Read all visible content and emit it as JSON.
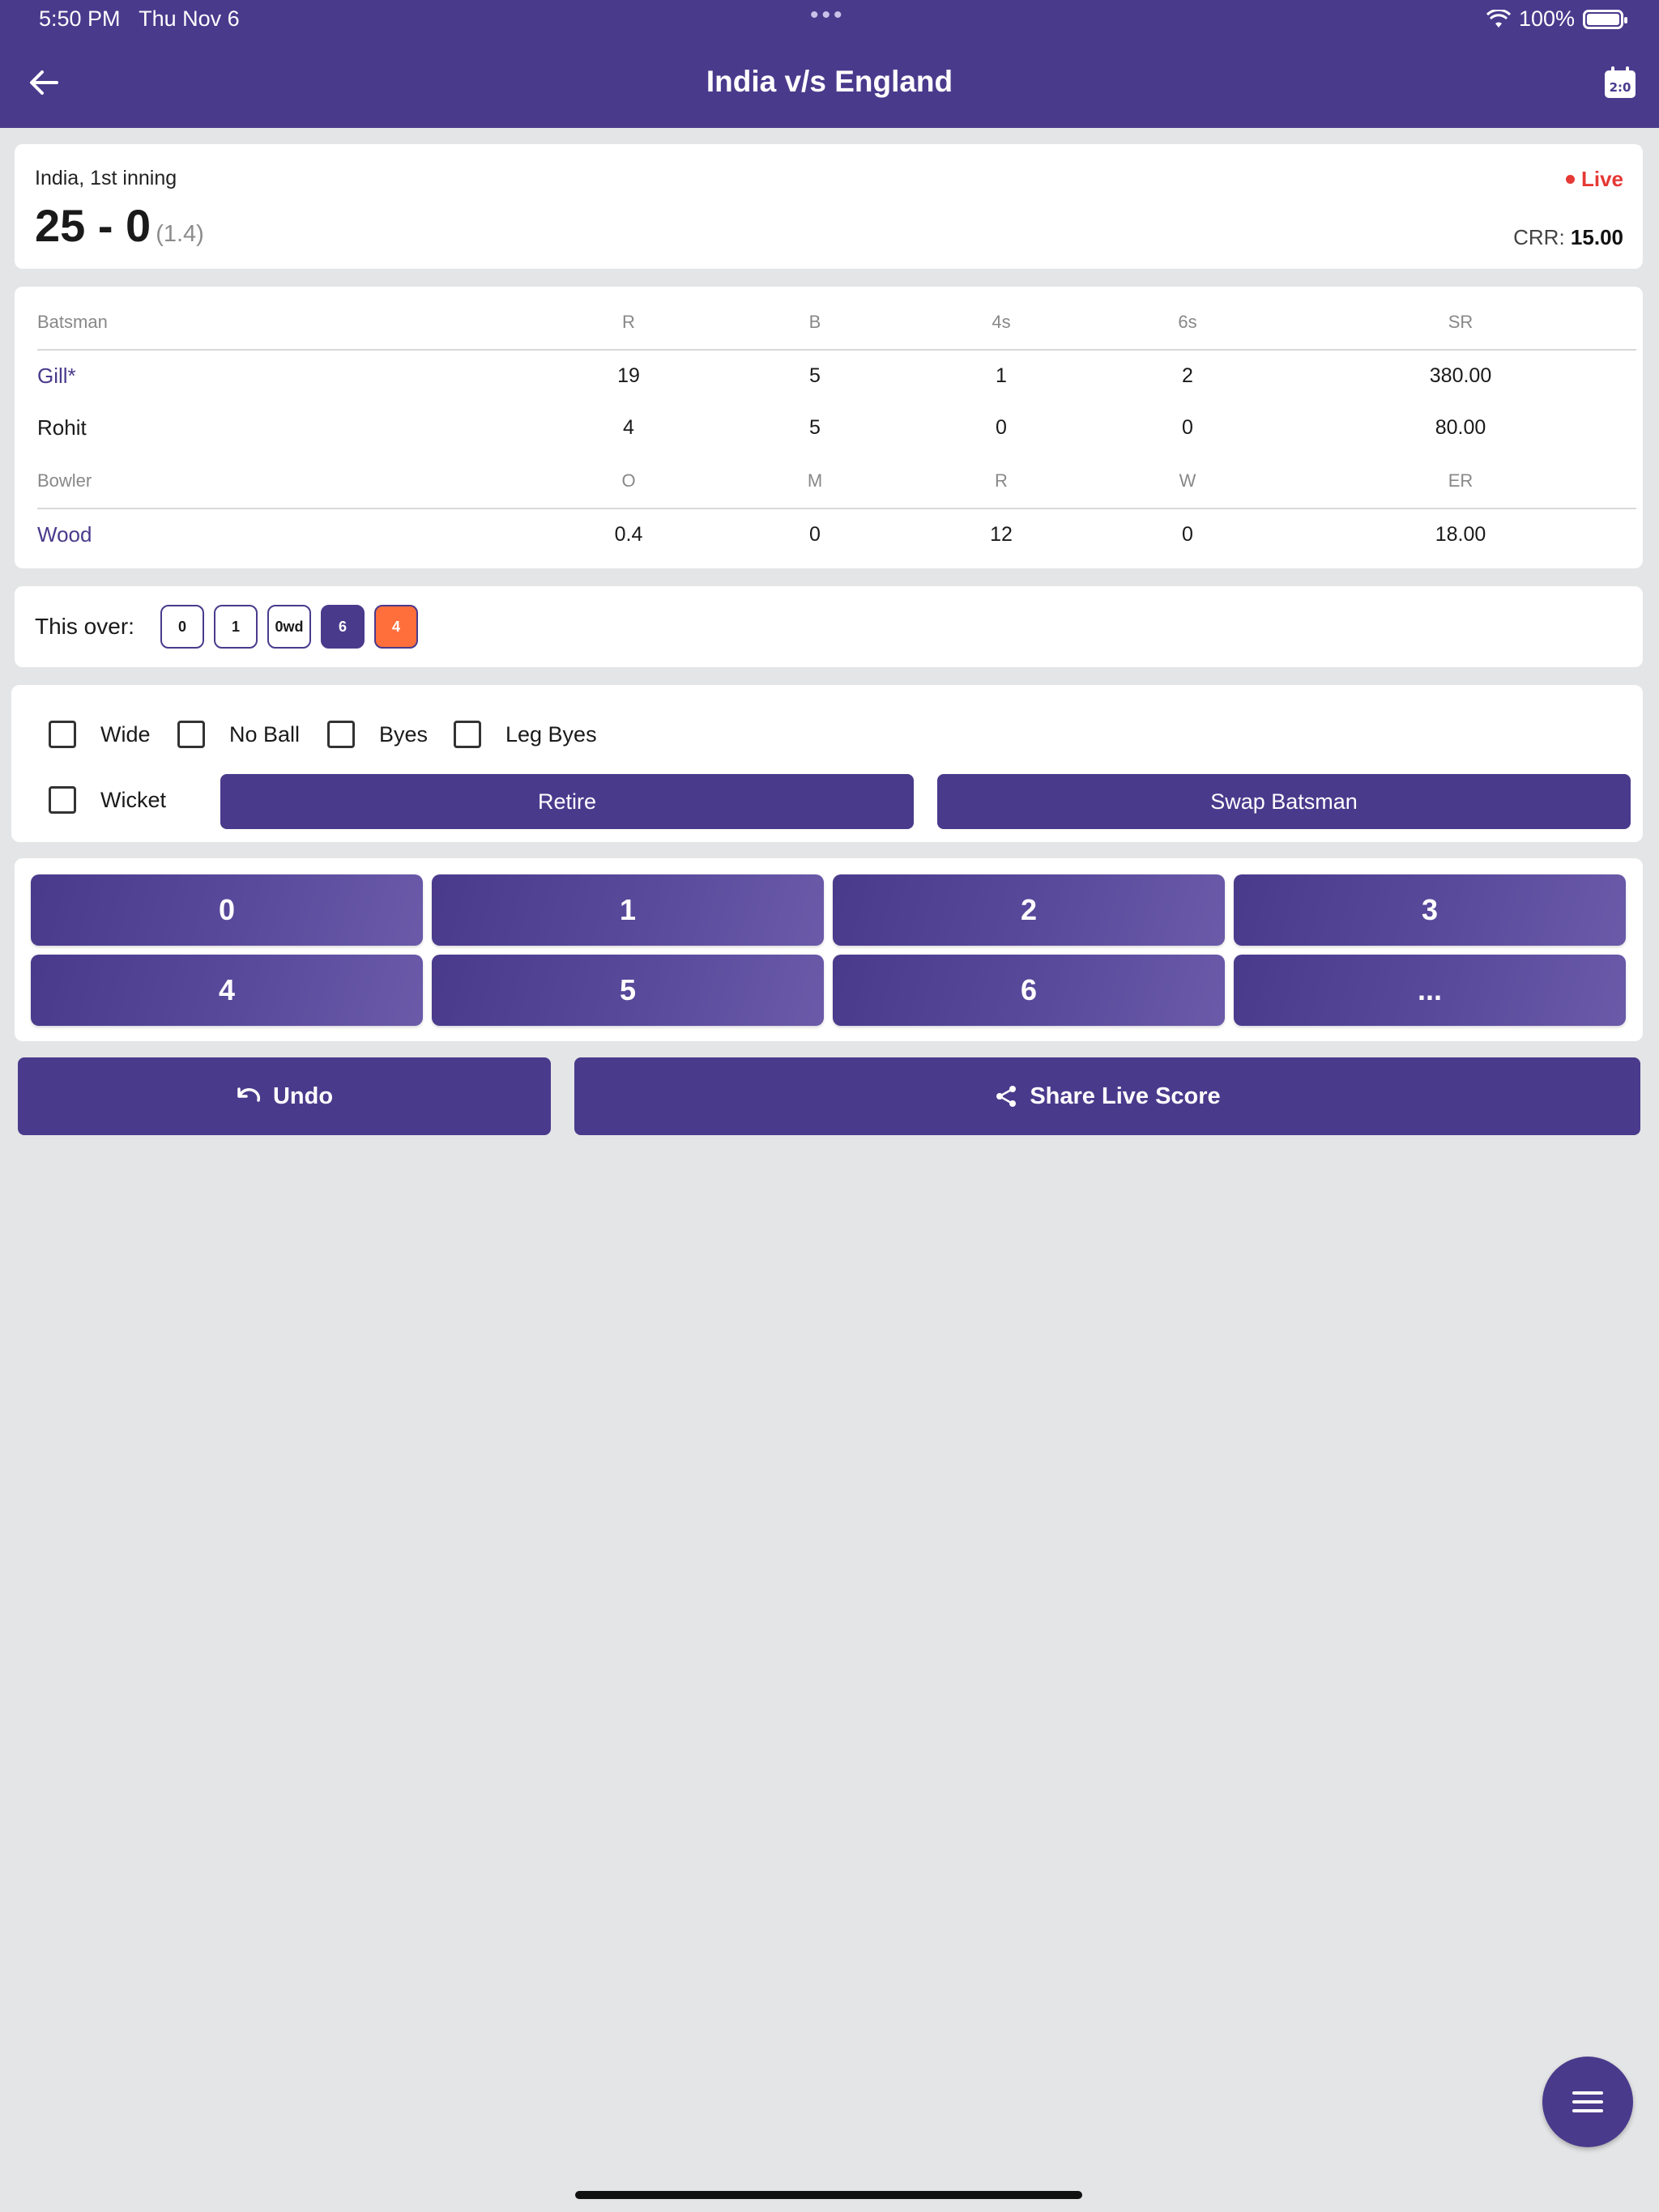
{
  "status_bar": {
    "time": "5:50 PM",
    "date": "Thu Nov 6",
    "battery": "100%",
    "dots": "•••"
  },
  "header": {
    "title": "India v/s England"
  },
  "score": {
    "innings": "India, 1st inning",
    "runs_wickets": "25 - 0",
    "overs": "(1.4)",
    "live": "Live",
    "crr_label": "CRR:",
    "crr_value": "15.00"
  },
  "batting": {
    "headers": [
      "Batsman",
      "R",
      "B",
      "4s",
      "6s",
      "SR"
    ],
    "rows": [
      [
        "Gill*",
        "19",
        "5",
        "1",
        "2",
        "380.00"
      ],
      [
        "Rohit",
        "4",
        "5",
        "0",
        "0",
        "80.00"
      ]
    ]
  },
  "bowling": {
    "headers": [
      "Bowler",
      "O",
      "M",
      "R",
      "W",
      "ER"
    ],
    "rows": [
      [
        "Wood",
        "0.4",
        "0",
        "12",
        "0",
        "18.00"
      ]
    ]
  },
  "this_over": {
    "label": "This over:",
    "balls": [
      "0",
      "1",
      "0wd",
      "6",
      "4"
    ]
  },
  "extras": {
    "wide": "Wide",
    "no_ball": "No Ball",
    "byes": "Byes",
    "leg_byes": "Leg Byes",
    "wicket": "Wicket",
    "retire": "Retire",
    "swap": "Swap Batsman"
  },
  "runs_pad": [
    "0",
    "1",
    "2",
    "3",
    "4",
    "5",
    "6",
    "..."
  ],
  "bottom": {
    "undo": "Undo",
    "share": "Share Live Score"
  },
  "colors": {
    "primary": "#4a3a8c",
    "live": "#e53935",
    "four": "#ff6f3c",
    "background": "#e4e5e6"
  }
}
